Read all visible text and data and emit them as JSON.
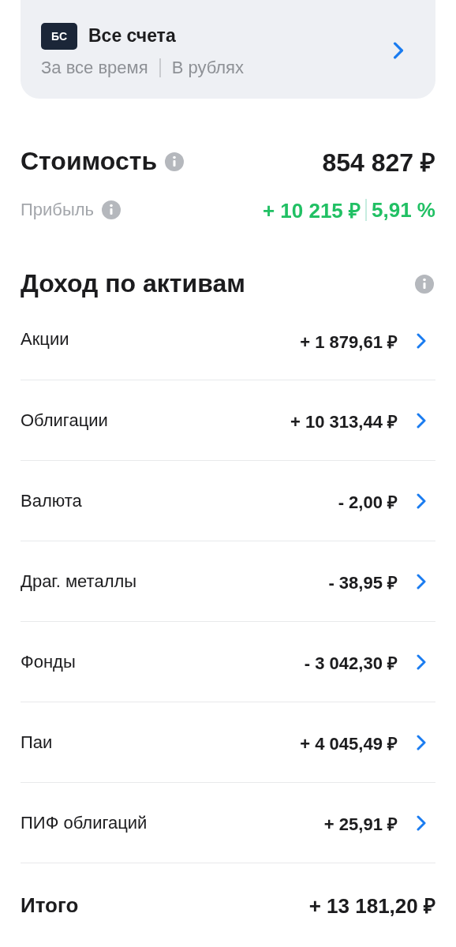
{
  "account": {
    "badge": "БС",
    "title": "Все счета",
    "period": "За все время",
    "currency": "В рублях"
  },
  "value": {
    "label": "Стоимость",
    "amount": "854 827 ₽"
  },
  "profit": {
    "label": "Прибыль",
    "amount": "+ 10 215 ₽",
    "percent": "5,91 %"
  },
  "income": {
    "title": "Доход по активам",
    "rows": [
      {
        "label": "Акции",
        "amount": "+ 1 879,61 ₽"
      },
      {
        "label": "Облигации",
        "amount": "+ 10 313,44 ₽"
      },
      {
        "label": "Валюта",
        "amount": "- 2,00 ₽"
      },
      {
        "label": "Драг. металлы",
        "amount": "- 38,95 ₽"
      },
      {
        "label": "Фонды",
        "amount": "- 3 042,30 ₽"
      },
      {
        "label": "Паи",
        "amount": "+ 4 045,49 ₽"
      },
      {
        "label": "ПИФ облигаций",
        "amount": "+ 25,91 ₽"
      }
    ],
    "total": {
      "label": "Итого",
      "amount": "+ 13 181,20 ₽"
    }
  }
}
